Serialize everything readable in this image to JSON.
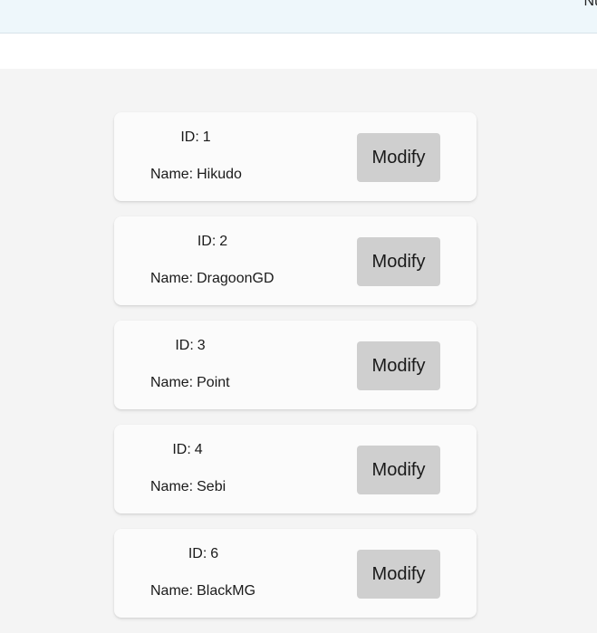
{
  "header": {
    "cut_text": "Nu"
  },
  "labels": {
    "id": "ID:",
    "name": "Name:"
  },
  "users": [
    {
      "id": "1",
      "name": "Hikudo",
      "button": "Modify"
    },
    {
      "id": "2",
      "name": "DragoonGD",
      "button": "Modify"
    },
    {
      "id": "3",
      "name": "Point",
      "button": "Modify"
    },
    {
      "id": "4",
      "name": "Sebi",
      "button": "Modify"
    },
    {
      "id": "6",
      "name": "BlackMG",
      "button": "Modify"
    }
  ],
  "colors": {
    "header_bg": "#eef7fb",
    "page_bg": "#f4f4f4",
    "card_bg": "#fbfbfb",
    "button_bg": "#cfcfcf"
  }
}
